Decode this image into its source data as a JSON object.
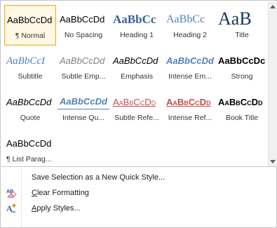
{
  "styles": [
    {
      "sample": "AaBbCcDd",
      "label": "¶ Normal"
    },
    {
      "sample": "AaBbCcDd",
      "label": "No Spacing"
    },
    {
      "sample": "AaBbCc",
      "label": "Heading 1"
    },
    {
      "sample": "AaBbCc",
      "label": "Heading 2"
    },
    {
      "sample": "AaB",
      "label": "Title"
    },
    {
      "sample": "AaBbCcI",
      "label": "Subtitle"
    },
    {
      "sample": "AaBbCcDd",
      "label": "Subtle Emp..."
    },
    {
      "sample": "AaBbCcDd",
      "label": "Emphasis"
    },
    {
      "sample": "AaBbCcDd",
      "label": "Intense Em..."
    },
    {
      "sample": "AaBbCcDc",
      "label": "Strong"
    },
    {
      "sample": "AaBbCcDd",
      "label": "Quote"
    },
    {
      "sample": "AaBbCcDd",
      "label": "Intense Qu..."
    },
    {
      "sample": "AaBbCcDd",
      "label": "Subtle Refe..."
    },
    {
      "sample": "AaBbCcDd",
      "label": "Intense Ref..."
    },
    {
      "sample": "AaBbCcDd",
      "label": "Book Title"
    },
    {
      "sample": "AaBbCcDd",
      "label": "¶ List Parag..."
    }
  ],
  "selected_style": "Normal",
  "menu": {
    "save_selection": "Save Selection as a New Quick Style...",
    "clear_formatting": "Clear Formatting",
    "apply_styles": "Apply Styles..."
  },
  "icons": {
    "scroll_up": "triangle-up",
    "scroll_down": "triangle-down",
    "clear_formatting": "eraser-ab",
    "apply_styles": "apply-styles-a"
  },
  "colors": {
    "selection_border": "#e3b74c",
    "selection_fill": "#fff8e4",
    "heading_blue": "#365f91",
    "accent_blue": "#4f81bd",
    "reference_red": "#c0504d"
  }
}
